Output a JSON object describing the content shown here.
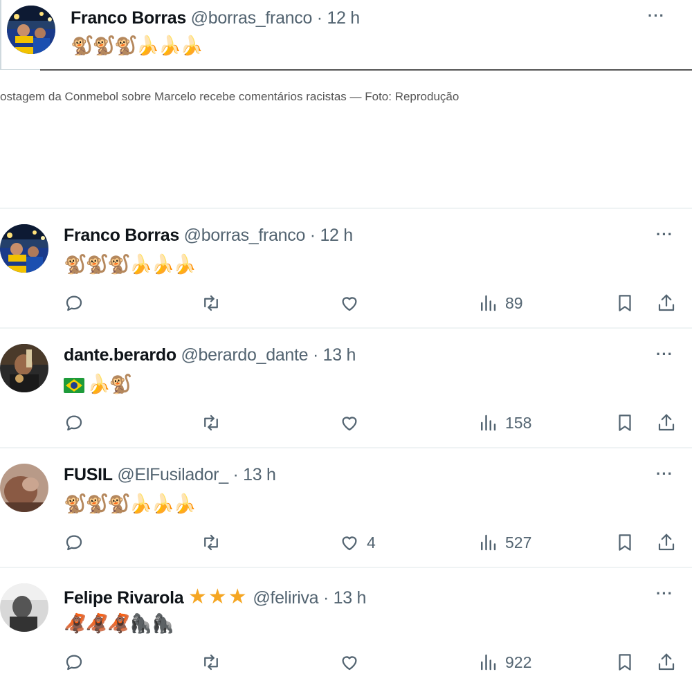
{
  "top_tweet": {
    "name": "Franco Borras",
    "handle": "@borras_franco",
    "separator": "·",
    "time": "12 h",
    "content": "🐒🐒🐒🍌🍌🍌",
    "more_label": "···"
  },
  "caption": "ostagem da Conmebol sobre Marcelo recebe comentários racistas — Foto: Reprodução",
  "tweets": [
    {
      "name": "Franco Borras",
      "handle": "@borras_franco",
      "separator": "·",
      "time": "12 h",
      "content": "🐒🐒🐒🍌🍌🍌",
      "likes": "",
      "views": "89",
      "more_label": "···"
    },
    {
      "name": "dante.berardo",
      "handle": "@berardo_dante",
      "separator": "·",
      "time": "13 h",
      "content": "🍌🐒",
      "likes": "",
      "views": "158",
      "more_label": "···"
    },
    {
      "name": "FUSIL",
      "handle": "@ElFusilador_",
      "separator": "·",
      "time": "13 h",
      "content": "🐒🐒🐒🍌🍌🍌",
      "likes": "4",
      "views": "527",
      "more_label": "···"
    },
    {
      "name": "Felipe Rivarola",
      "stars": "★★★",
      "handle": "@feliriva",
      "separator": "·",
      "time": "13 h",
      "content": "🦧🦧🦧🦍🦍",
      "likes": "",
      "views": "922",
      "more_label": "···"
    }
  ],
  "icons": {
    "reply": "reply-icon",
    "retweet": "retweet-icon",
    "like": "heart-icon",
    "views": "views-icon",
    "bookmark": "bookmark-icon",
    "share": "share-icon",
    "more": "more-icon",
    "flag": "brazil-flag-icon"
  },
  "colors": {
    "text_primary": "#0f1419",
    "text_secondary": "#536471",
    "divider": "#eff3f4",
    "star": "#f5a623"
  }
}
